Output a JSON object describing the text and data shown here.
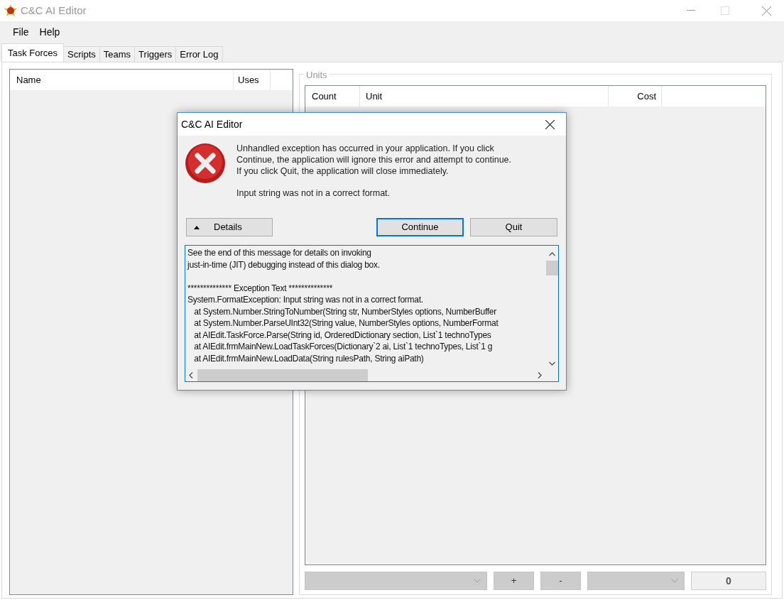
{
  "window": {
    "title": "C&C AI Editor"
  },
  "menu": [
    "File",
    "Help"
  ],
  "tabs": [
    {
      "label": "Task Forces",
      "selected": true
    },
    {
      "label": "Scripts",
      "selected": false
    },
    {
      "label": "Teams",
      "selected": false
    },
    {
      "label": "Triggers",
      "selected": false
    },
    {
      "label": "Error Log",
      "selected": false
    }
  ],
  "task_forces_list": {
    "columns": [
      "Name",
      "Uses"
    ]
  },
  "units_group": {
    "title": "Units",
    "columns": [
      "Count",
      "Unit",
      "Cost"
    ],
    "add_button": "+",
    "remove_button": "-",
    "total": "0"
  },
  "dialog": {
    "title": "C&C AI Editor",
    "message": [
      "Unhandled exception has occurred in your application. If you click",
      "Continue, the application will ignore this error and attempt to continue.",
      "If you click Quit, the application will close immediately."
    ],
    "error": "Input string was not in a correct format.",
    "details_button": "Details",
    "details_expanded": true,
    "continue_button": "Continue",
    "quit_button": "Quit",
    "details_blocks": [
      [
        "See the end of this message for details on invoking",
        "just-in-time (JIT) debugging instead of this dialog box."
      ],
      [
        "************** Exception Text **************",
        "System.FormatException: Input string was not in a correct format.",
        "   at System.Number.StringToNumber(String str, NumberStyles options, NumberBuffer",
        "   at System.Number.ParseUInt32(String value, NumberStyles options, NumberFormat",
        "   at AIEdit.TaskForce.Parse(String id, OrderedDictionary section, List`1 technoTypes",
        "   at AIEdit.frmMainNew.LoadTaskForces(Dictionary`2 ai, List`1 technoTypes, List`1 g",
        "   at AIEdit.frmMainNew.LoadData(String rulesPath, String aiPath)"
      ]
    ]
  }
}
